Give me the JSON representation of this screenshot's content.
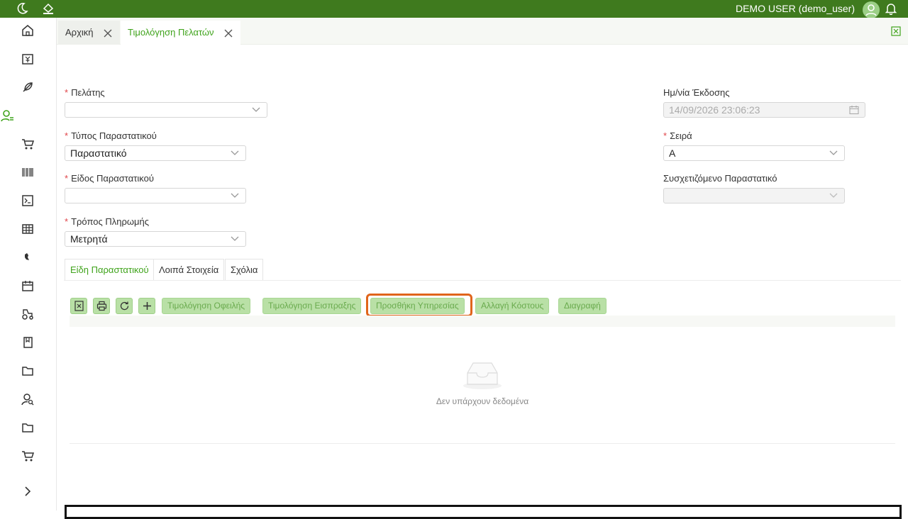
{
  "topbar": {
    "user_label": "DEMO USER (demo_user)",
    "icons": [
      "moon-icon",
      "paint-bucket-icon",
      "avatar-icon",
      "bell-icon"
    ]
  },
  "sidebar": {
    "items": [
      "home-icon",
      "invoice-yen-icon",
      "feather-icon",
      "user-customers-icon",
      "cart-icon",
      "barcode-icon",
      "terminal-icon",
      "table-icon",
      "bird-icon",
      "calendar-icon",
      "tractor-icon",
      "bookmark-icon",
      "folder-icon",
      "user-search-icon",
      "folder-icon",
      "cart-icon"
    ],
    "expand_icon": "chevron-right-icon"
  },
  "tabs": [
    {
      "label": "Αρχική",
      "active": false
    },
    {
      "label": "Τιμολόγηση Πελατών",
      "active": true
    }
  ],
  "form": {
    "customer": {
      "label": "Πελάτης",
      "value": ""
    },
    "doc_type": {
      "label": "Τύπος Παραστατικού",
      "value": "Παραστατικό"
    },
    "doc_kind": {
      "label": "Είδος Παραστατικού",
      "value": ""
    },
    "payment": {
      "label": "Τρόπος Πληρωμής",
      "value": "Μετρητά"
    },
    "issue_date": {
      "label": "Ημ/νία Έκδοσης",
      "value": "14/09/2026 23:06:23"
    },
    "series": {
      "label": "Σειρά",
      "value": "Α"
    },
    "related_doc": {
      "label": "Συσχετιζόμενο Παραστατικό",
      "value": ""
    }
  },
  "inner_tabs": [
    {
      "label": "Είδη Παραστατικού",
      "active": true
    },
    {
      "label": "Λοιπά Στοιχεία",
      "active": false
    },
    {
      "label": "Σχόλια",
      "active": false
    }
  ],
  "toolbar": {
    "icon_buttons": [
      "excel-export-icon",
      "print-icon",
      "refresh-icon",
      "plus-icon"
    ],
    "invoice_debt": "Τιμολόγηση Οφειλής",
    "invoice_receipt": "Τιμολόγηση Εισπραξης",
    "add_service": "Προσθήκη Υπηρεσίας",
    "change_cost": "Αλλαγή Κόστους",
    "delete": "Διαγραφή"
  },
  "table": {
    "empty_text": "Δεν υπάρχουν δεδομένα"
  },
  "colors": {
    "topbar": "#3f7a1e",
    "accent": "#3fa31b",
    "button_bg": "#b9e0a6",
    "highlight": "#e0651c",
    "required": "#e0454a"
  }
}
